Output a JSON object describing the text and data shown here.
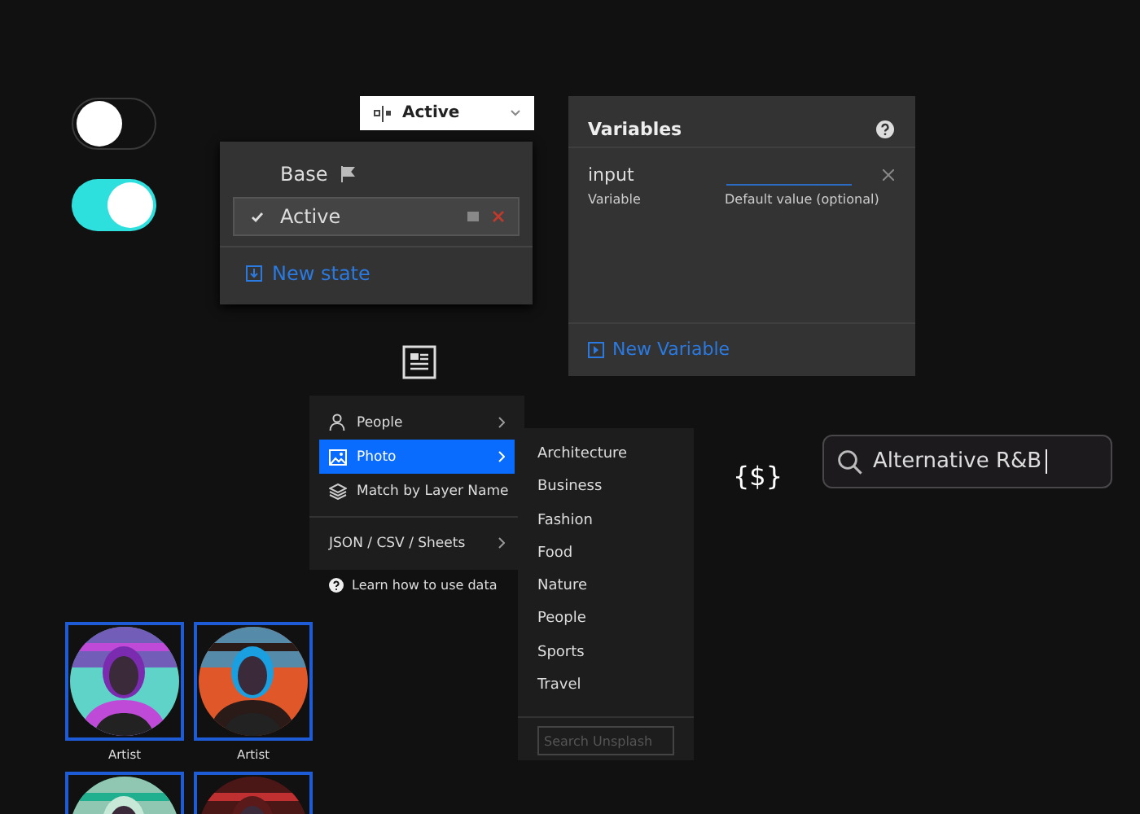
{
  "toggles": [
    {
      "on": false
    },
    {
      "on": true
    }
  ],
  "state_dropdown": {
    "value": "Active"
  },
  "states_menu": {
    "items": [
      {
        "label": "Base",
        "kind": "base",
        "selected": false
      },
      {
        "label": "Active",
        "kind": "state",
        "selected": true
      }
    ],
    "new_button": "New state"
  },
  "variables_panel": {
    "title": "Variables",
    "name": "input",
    "type_label": "Variable",
    "default_placeholder": "Default value (optional)",
    "new_button": "New Variable"
  },
  "data_menu": {
    "items": [
      {
        "label": "People",
        "kind": "submenu",
        "selected": false
      },
      {
        "label": "Photo",
        "kind": "submenu",
        "selected": true
      },
      {
        "label": "Match by Layer Name",
        "kind": "action",
        "selected": false
      },
      {
        "label": "JSON / CSV / Sheets",
        "kind": "submenu",
        "selected": false
      }
    ],
    "help_link": "Learn how to use data"
  },
  "photo_submenu": {
    "items": [
      "Architecture",
      "Business",
      "Fashion",
      "Food",
      "Nature",
      "People",
      "Sports",
      "Travel"
    ],
    "search": {
      "placeholder": "Search Unsplash"
    }
  },
  "variable_symbol": "{$}",
  "search": {
    "value": "Alternative R&B"
  },
  "artists": [
    {
      "kind": "picture",
      "caption": "Artist"
    },
    {
      "kind": "picture",
      "caption": "Artist"
    },
    {
      "kind": "picture"
    },
    {
      "kind": "picture"
    }
  ]
}
